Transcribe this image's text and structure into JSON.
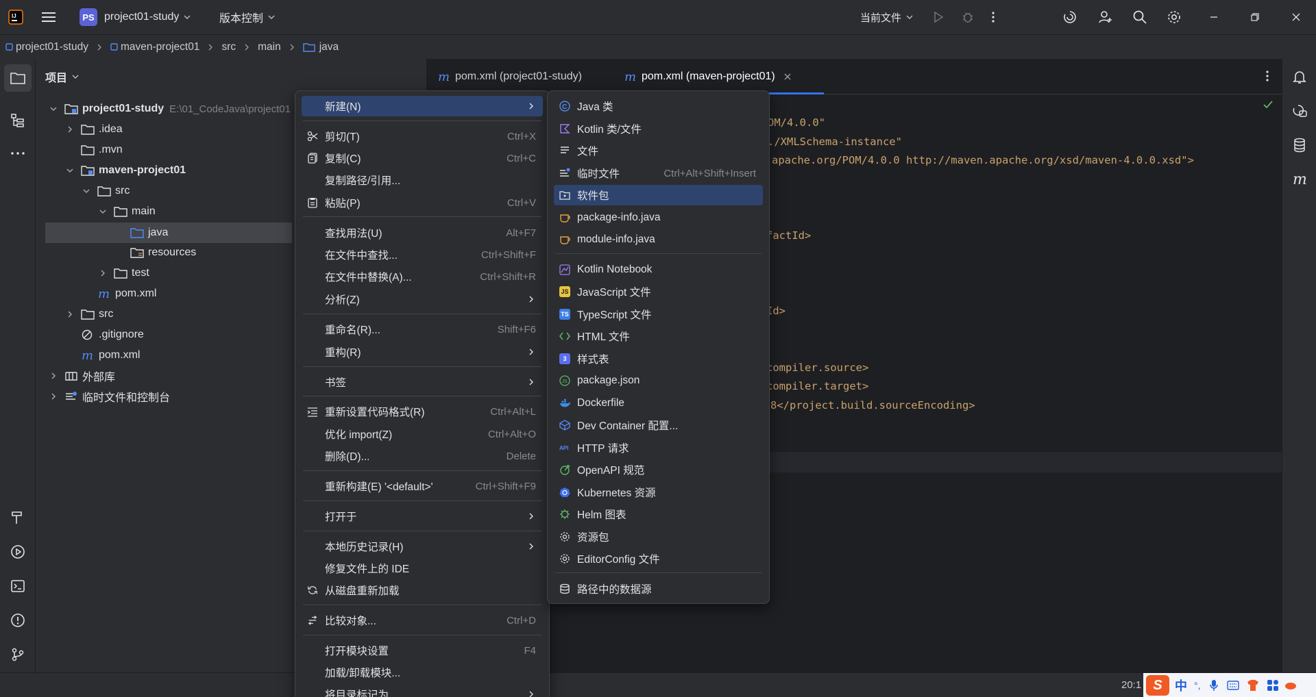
{
  "titlebar": {
    "project_badge": "PS",
    "project_name": "project01-study",
    "vcs": "版本控制",
    "run_config": "当前文件"
  },
  "breadcrumb": [
    "project01-study",
    "maven-project01",
    "src",
    "main",
    "java"
  ],
  "project_panel": {
    "title": "项目",
    "tree": [
      {
        "label": "project01-study",
        "path": "E:\\01_CodeJava\\project01"
      },
      {
        "label": ".idea"
      },
      {
        "label": ".mvn"
      },
      {
        "label": "maven-project01"
      },
      {
        "label": "src"
      },
      {
        "label": "main"
      },
      {
        "label": "java"
      },
      {
        "label": "resources"
      },
      {
        "label": "test"
      },
      {
        "label": "pom.xml"
      },
      {
        "label": "src"
      },
      {
        "label": ".gitignore"
      },
      {
        "label": "pom.xml"
      },
      {
        "label": "外部库"
      },
      {
        "label": "临时文件和控制台"
      }
    ]
  },
  "tabs": [
    {
      "label": "pom.xml (project01-study)"
    },
    {
      "label": "pom.xml (maven-project01)"
    }
  ],
  "code_lines": [
    "OM/4.0.0\"",
    "./XMLSchema-instance\"",
    "apache.org/POM/4.0.0 http://maven.apache.org/xsd/maven-4.0.0.xsd\">",
    "factId>",
    "Id>",
    "compiler.source>",
    "compiler.target>",
    "8</project.build.sourceEncoding>"
  ],
  "context_menu": [
    {
      "label": "新建(N)",
      "shortcut": ""
    },
    {
      "label": "剪切(T)",
      "shortcut": "Ctrl+X"
    },
    {
      "label": "复制(C)",
      "shortcut": "Ctrl+C"
    },
    {
      "label": "复制路径/引用...",
      "shortcut": ""
    },
    {
      "label": "粘贴(P)",
      "shortcut": "Ctrl+V"
    },
    {
      "label": "查找用法(U)",
      "shortcut": "Alt+F7"
    },
    {
      "label": "在文件中查找...",
      "shortcut": "Ctrl+Shift+F"
    },
    {
      "label": "在文件中替换(A)...",
      "shortcut": "Ctrl+Shift+R"
    },
    {
      "label": "分析(Z)",
      "shortcut": ""
    },
    {
      "label": "重命名(R)...",
      "shortcut": "Shift+F6"
    },
    {
      "label": "重构(R)",
      "shortcut": ""
    },
    {
      "label": "书签",
      "shortcut": ""
    },
    {
      "label": "重新设置代码格式(R)",
      "shortcut": "Ctrl+Alt+L"
    },
    {
      "label": "优化 import(Z)",
      "shortcut": "Ctrl+Alt+O"
    },
    {
      "label": "删除(D)...",
      "shortcut": "Delete"
    },
    {
      "label": "重新构建(E) '<default>'",
      "shortcut": "Ctrl+Shift+F9"
    },
    {
      "label": "打开于",
      "shortcut": ""
    },
    {
      "label": "本地历史记录(H)",
      "shortcut": ""
    },
    {
      "label": "修复文件上的 IDE",
      "shortcut": ""
    },
    {
      "label": "从磁盘重新加载",
      "shortcut": ""
    },
    {
      "label": "比较对象...",
      "shortcut": "Ctrl+D"
    },
    {
      "label": "打开模块设置",
      "shortcut": "F4"
    },
    {
      "label": "加载/卸载模块...",
      "shortcut": ""
    },
    {
      "label": "将目录标记为",
      "shortcut": ""
    }
  ],
  "new_submenu": [
    {
      "label": "Java 类",
      "shortcut": ""
    },
    {
      "label": "Kotlin 类/文件",
      "shortcut": ""
    },
    {
      "label": "文件",
      "shortcut": ""
    },
    {
      "label": "临时文件",
      "shortcut": "Ctrl+Alt+Shift+Insert"
    },
    {
      "label": "软件包",
      "shortcut": ""
    },
    {
      "label": "package-info.java",
      "shortcut": ""
    },
    {
      "label": "module-info.java",
      "shortcut": ""
    },
    {
      "label": "Kotlin Notebook",
      "shortcut": ""
    },
    {
      "label": "JavaScript 文件",
      "shortcut": ""
    },
    {
      "label": "TypeScript 文件",
      "shortcut": ""
    },
    {
      "label": "HTML 文件",
      "shortcut": ""
    },
    {
      "label": "样式表",
      "shortcut": ""
    },
    {
      "label": "package.json",
      "shortcut": ""
    },
    {
      "label": "Dockerfile",
      "shortcut": ""
    },
    {
      "label": "Dev Container 配置...",
      "shortcut": ""
    },
    {
      "label": "HTTP 请求",
      "shortcut": ""
    },
    {
      "label": "OpenAPI 规范",
      "shortcut": ""
    },
    {
      "label": "Kubernetes 资源",
      "shortcut": ""
    },
    {
      "label": "Helm 图表",
      "shortcut": ""
    },
    {
      "label": "资源包",
      "shortcut": ""
    },
    {
      "label": "EditorConfig 文件",
      "shortcut": ""
    },
    {
      "label": "路径中的数据源",
      "shortcut": ""
    }
  ],
  "statusbar": {
    "position": "20:1",
    "ime": [
      "中",
      "°,"
    ]
  },
  "colors": {
    "background": "#1e1f22",
    "panel": "#2b2d30",
    "selection": "#2e436e",
    "accent": "#3574f0",
    "code_string": "#c9a26d"
  }
}
